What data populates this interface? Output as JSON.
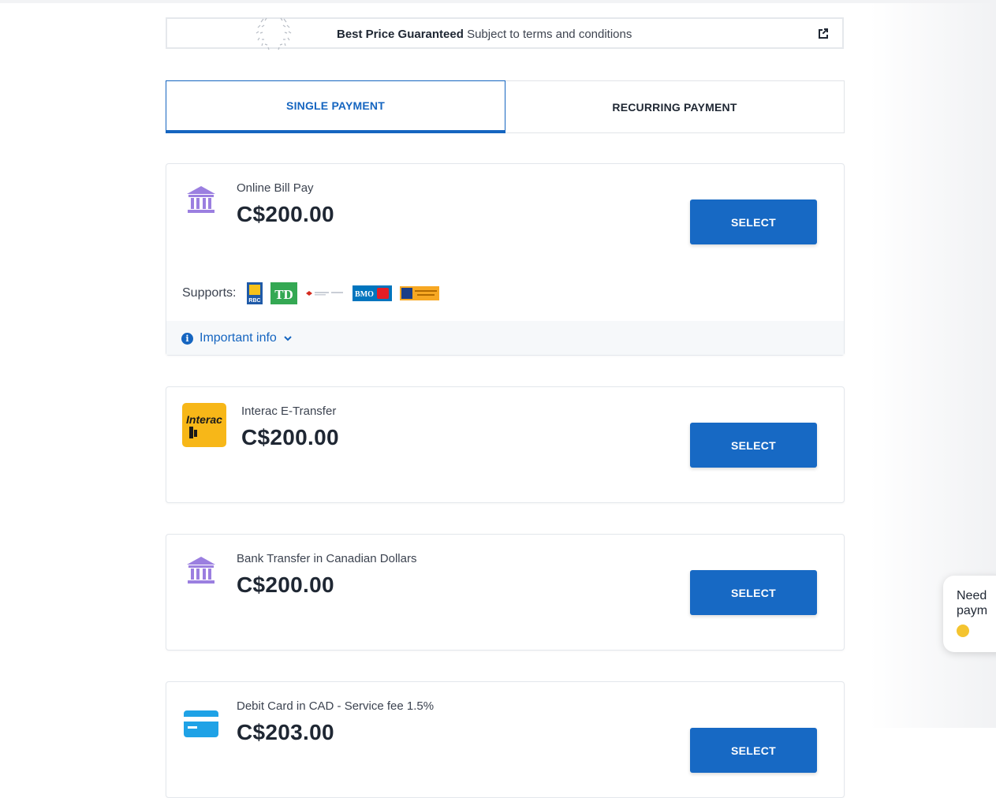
{
  "banner": {
    "title": "Best Price Guaranteed",
    "subtitle": "Subject to terms and conditions"
  },
  "tabs": [
    {
      "label": "SINGLE PAYMENT",
      "active": true
    },
    {
      "label": "RECURRING PAYMENT",
      "active": false
    }
  ],
  "cards": [
    {
      "name": "Online Bill Pay",
      "price": "C$200.00",
      "button": "SELECT",
      "icon": "bank-icon"
    },
    {
      "name": "Interac E-Transfer",
      "price": "C$200.00",
      "button": "SELECT",
      "icon": "interac-logo"
    },
    {
      "name": "Bank Transfer in Canadian Dollars",
      "price": "C$200.00",
      "button": "SELECT",
      "icon": "bank-icon"
    },
    {
      "name": "Debit Card in CAD - Service fee 1.5%",
      "price": "C$203.00",
      "button": "SELECT",
      "icon": "card-icon"
    }
  ],
  "supports": {
    "label": "Supports:",
    "banks": [
      "RBC",
      "TD",
      "National Bank",
      "BMO",
      "Laurentian Bank"
    ]
  },
  "info": {
    "label": "Important info"
  },
  "chat": {
    "text": "Need\npaym"
  },
  "colors": {
    "accent": "#1769c4",
    "bank_icon": "#9b7fe0",
    "interac": "#f7b718"
  }
}
